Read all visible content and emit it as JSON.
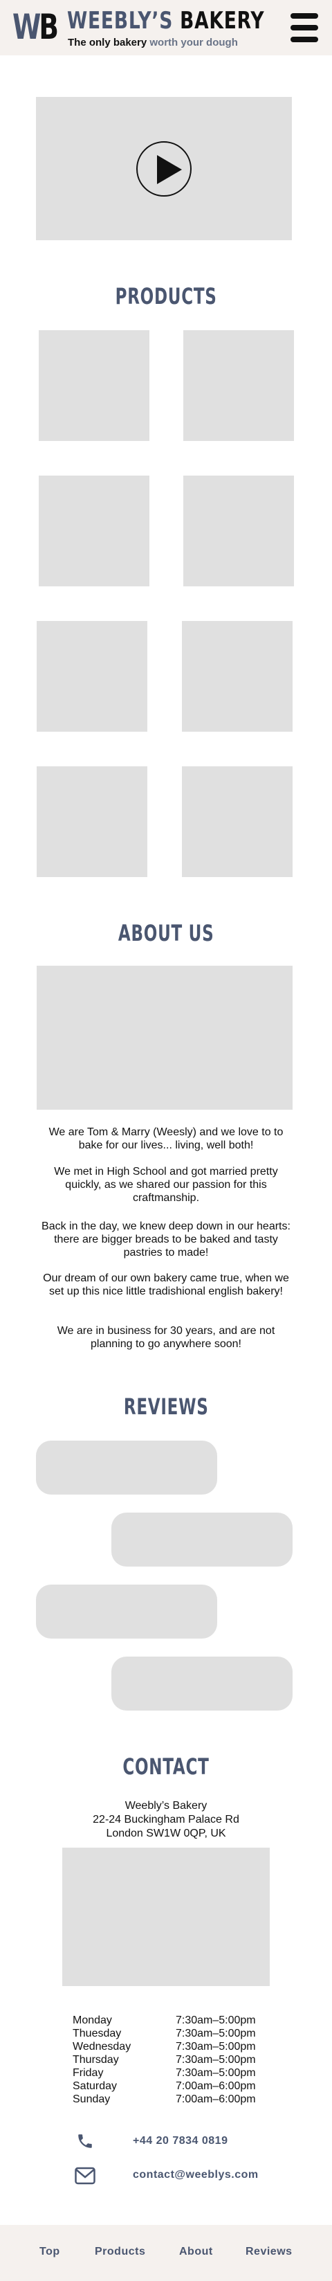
{
  "header": {
    "logo_w": "W",
    "logo_b": "B",
    "title_part1": "WEEBLY’S",
    "title_part2": "BAKERY",
    "tagline_part1": "The only bakery",
    "tagline_part2": "worth your dough"
  },
  "sections": {
    "products_title": "PRODUCTS",
    "about_title": "ABOUT US",
    "reviews_title": "REVIEWS",
    "contact_title": "CONTACT"
  },
  "about": {
    "paragraphs": [
      "We are Tom & Marry (Weesly) and we love to to bake for our lives... living, well both!",
      "We met in High School and got married pretty quickly, as we shared our passion for this craftmanship.",
      "Back in the day, we knew deep down in our hearts: there are bigger breads to be baked and tasty pastries to made!",
      "Our dream of our own bakery came true, when we set up this nice little tradishional english bakery!",
      "We are in business for 30 years, and are not planning to go anywhere soon!"
    ]
  },
  "contact": {
    "name": "Weebly’s Bakery",
    "street": "22-24 Buckingham Palace Rd",
    "city": "London SW1W 0QP, UK",
    "hours": [
      {
        "day": "Monday",
        "time": "7:30am–5:00pm"
      },
      {
        "day": "Thuesday",
        "time": "7:30am–5:00pm"
      },
      {
        "day": "Wednesday",
        "time": "7:30am–5:00pm"
      },
      {
        "day": "Thursday",
        "time": "7:30am–5:00pm"
      },
      {
        "day": "Friday",
        "time": "7:30am–5:00pm"
      },
      {
        "day": "Saturday",
        "time": "7:00am–6:00pm"
      },
      {
        "day": "Sunday",
        "time": "7:00am–6:00pm"
      }
    ],
    "phone": "+44 20 7834 0819",
    "email": "contact@weeblys.com"
  },
  "footer": {
    "links": [
      "Top",
      "Products",
      "About",
      "Reviews"
    ]
  },
  "colors": {
    "accent": "#4a5670",
    "header_bg": "#f5f1ee",
    "placeholder": "#e0e0e0"
  }
}
